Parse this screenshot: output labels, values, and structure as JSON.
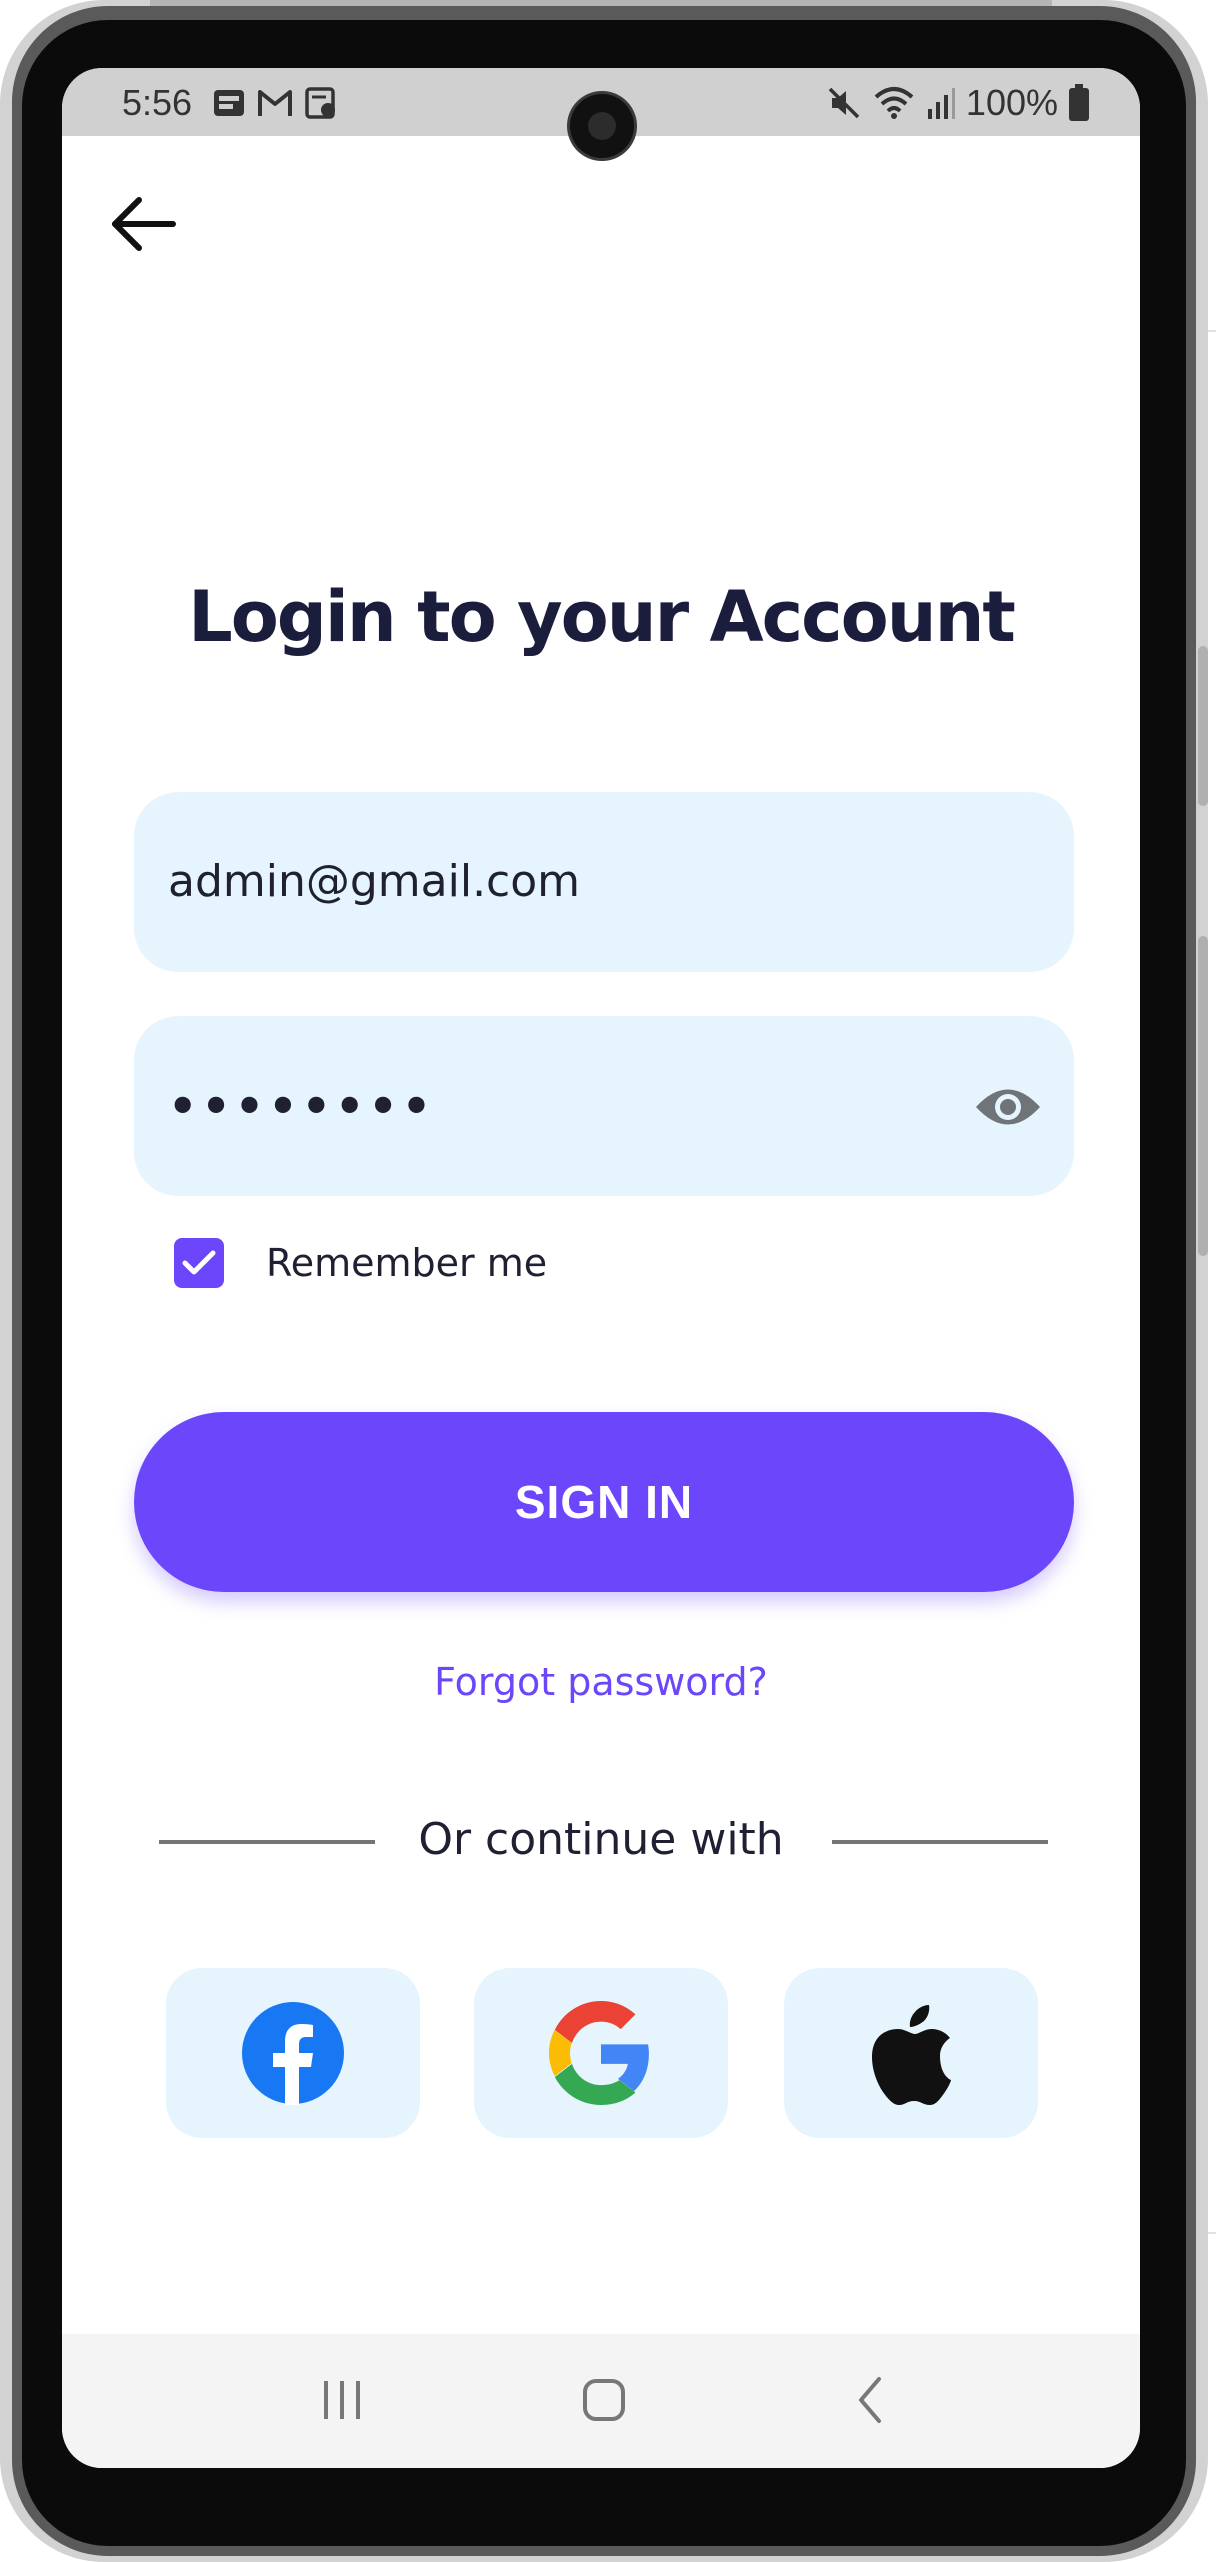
{
  "status_bar": {
    "time": "5:56",
    "battery": "100%",
    "left_icons": [
      "notification-app-icon",
      "gmail-icon",
      "task-icon"
    ],
    "right_icons": [
      "mute-icon",
      "wifi-icon",
      "signal-icon",
      "battery-icon"
    ]
  },
  "header": {
    "back_icon": "arrow-left-icon"
  },
  "login": {
    "title": "Login to your Account",
    "email_value": "admin@gmail.com",
    "password_value": "••••••••",
    "password_toggle_icon": "eye-icon",
    "remember_label": "Remember me",
    "remember_checked": true,
    "sign_in_label": "SIGN IN",
    "forgot_label": "Forgot password?",
    "divider_label": "Or continue with",
    "social": [
      {
        "icon": "facebook-icon"
      },
      {
        "icon": "google-icon"
      },
      {
        "icon": "apple-icon"
      }
    ]
  },
  "nav_bar": {
    "icons": [
      "recent-apps-icon",
      "home-icon",
      "back-nav-icon"
    ]
  },
  "colors": {
    "accent": "#6b46fb",
    "title": "#1b1d3d",
    "field_bg": "#e6f4fd"
  }
}
